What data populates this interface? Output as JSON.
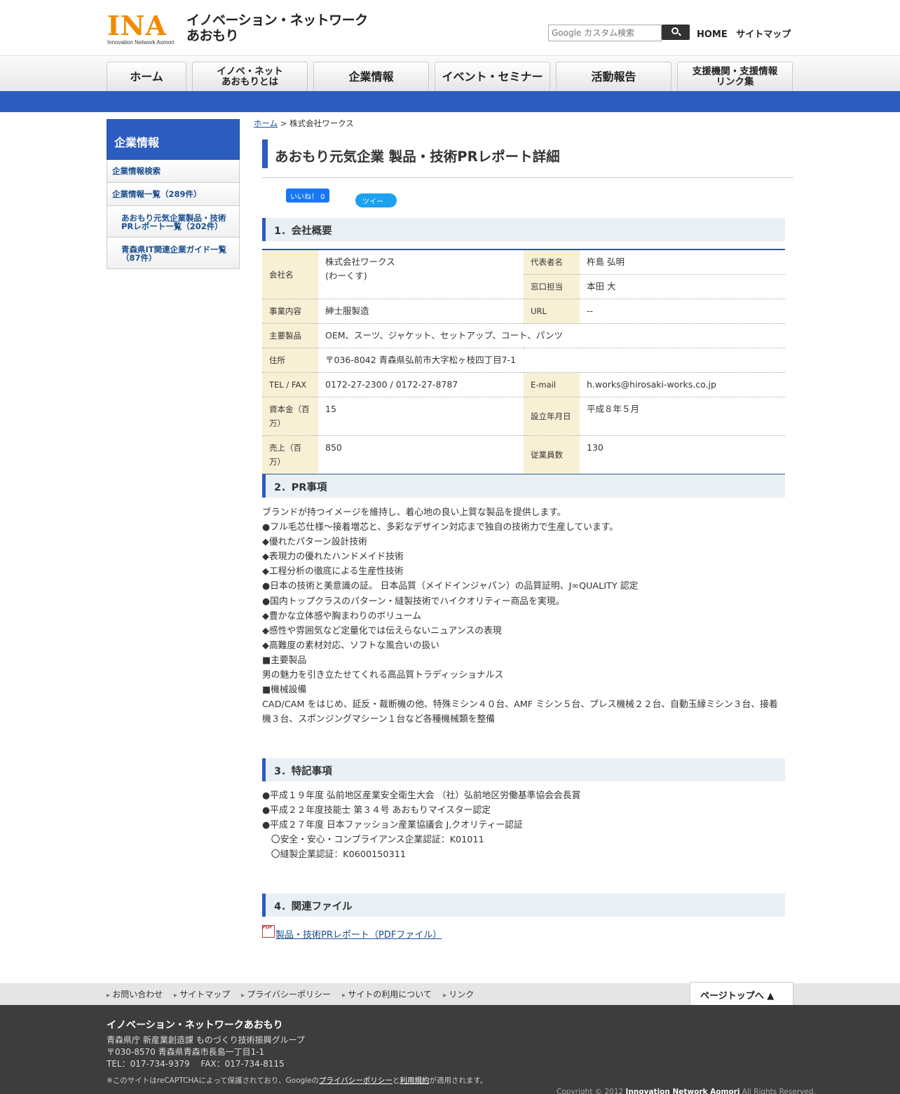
{
  "header": {
    "logo_text": "INA",
    "logo_sub": "Innovation Network Aomori",
    "site_title_line1": "イノベーション・ネットワーク",
    "site_title_line2": "あおもり",
    "search_placeholder": "Google カスタム検索",
    "home_link": "HOME",
    "sitemap_link": "サイトマップ"
  },
  "nav": [
    {
      "line1": "ホーム",
      "line2": ""
    },
    {
      "line1": "イノベ・ネット",
      "line2": "あおもりとは"
    },
    {
      "line1": "企業情報",
      "line2": ""
    },
    {
      "line1": "イベント・セミナー",
      "line2": ""
    },
    {
      "line1": "活動報告",
      "line2": ""
    },
    {
      "line1": "支援機関・支援情報",
      "line2": "リンク集"
    }
  ],
  "sidebar": {
    "title": "企業情報",
    "items": [
      {
        "label": "企業情報検索"
      },
      {
        "label": "企業情報一覧（289件）"
      },
      {
        "label": "あおもり元気企業製品・技術PRレポート一覧（202件）"
      },
      {
        "label": "青森県IT関連企業ガイド一覧（87件）"
      }
    ]
  },
  "breadcrumb": {
    "home": "ホーム",
    "sep": " > ",
    "current": "株式会社ワークス"
  },
  "page_title": "あおもり元気企業 製品・技術PRレポート詳細",
  "social": {
    "fb_label": "いいね！ 0",
    "tw_label": "ツイート"
  },
  "sections": {
    "s1": "1．会社概要",
    "s2": "2．PR事項",
    "s3": "3．特記事項",
    "s4": "4．関連ファイル"
  },
  "company": {
    "name_label": "会社名",
    "name_line1": "株式会社ワークス",
    "name_line2": "(わーくす)",
    "rep_label": "代表者名",
    "rep_value": "杵島 弘明",
    "contact_label": "窓口担当",
    "contact_value": "本田 大",
    "business_label": "事業内容",
    "business_value": "紳士服製造",
    "url_label": "URL",
    "url_value": "--",
    "products_label": "主要製品",
    "products_value": "OEM、スーツ、ジャケット、セットアップ、コート、パンツ",
    "address_label": "住所",
    "address_value": "〒036-8042 青森県弘前市大字松ヶ枝四丁目7-1",
    "tel_label": "TEL / FAX",
    "tel_value": "0172-27-2300 / 0172-27-8787",
    "email_label": "E-mail",
    "email_value": "h.works@hirosaki-works.co.jp",
    "capital_label": "資本金（百万）",
    "capital_value": "15",
    "founded_label": "設立年月日",
    "founded_value": "平成８年５月",
    "sales_label": "売上（百万）",
    "sales_value": "850",
    "employees_label": "従業員数",
    "employees_value": "130"
  },
  "pr_lines": [
    "ブランドが持つイメージを維持し、着心地の良い上質な製品を提供します。",
    "●フル毛芯仕様～接着増芯と、多彩なデザイン対応まで独自の技術力で生産しています。",
    "◆優れたパターン設計技術",
    "◆表現力の優れたハンドメイド技術",
    "◆工程分析の徹底による生産性技術",
    "●日本の技術と美意識の証。 日本品質（メイドインジャパン）の品質証明、J∞QUALITY 認定",
    "●国内トップクラスのパターン・縫製技術でハイクオリティー商品を実現。",
    "◆豊かな立体感や胸まわりのボリューム",
    "◆感性や雰囲気など定量化では伝えらないニュアンスの表現",
    "◆高難度の素材対応、ソフトな風合いの扱い",
    "■主要製品",
    "男の魅力を引き立たせてくれる高品質トラディッショナルス",
    "■機械設備",
    "CAD/CAM をはじめ、延反・裁断機の他、特殊ミシン４０台、AMF ミシン５台、プレス機械２２台、自動玉縁ミシン３台、接着機３台、スポンジングマシーン１台など各種機械類を整備"
  ],
  "notes_lines": [
    "●平成１９年度 弘前地区産業安全衛生大会 （社）弘前地区労働基準協会会長賞",
    "●平成２２年度技能士 第３４号 あおもりマイスター認定",
    "●平成２７年度 日本ファッション産業協議会 J,クオリティー認証",
    "　〇安全・安心・コンプライアンス企業認証：K01011",
    "　〇縫製企業認証：K0600150311"
  ],
  "files": {
    "pdf_icon_text": "PDF",
    "pdf_label": "製品・技術PRレポート（PDFファイル）"
  },
  "footer": {
    "links": [
      "お問い合わせ",
      "サイトマップ",
      "プライバシーポリシー",
      "サイトの利用について",
      "リンク"
    ],
    "pagetop": "ページトップへ ▲",
    "org": "イノベーション・ネットワークあおもり",
    "addr1": "青森県庁 新産業創造課 ものづくり技術振興グループ",
    "addr2": "〒030-8570 青森県青森市長島一丁目1-1",
    "addr3": "TEL：017-734-9379　 FAX：017-734-8115",
    "note_pre": "※このサイトはreCAPTCHAによって保護されており、Googleの",
    "note_privacy": "プライバシーポリシー",
    "note_and": "と",
    "note_terms": "利用規約",
    "note_post": "が適用されます。",
    "copy_pre": "Copyright © 2012 ",
    "copy_org": "Innovation Network Aomori",
    "copy_post": " All Rights Reserved."
  },
  "colors": {
    "accent_blue": "#2c5cbf",
    "logo_orange": "#f08a00",
    "label_bg": "#f8f0d5"
  }
}
